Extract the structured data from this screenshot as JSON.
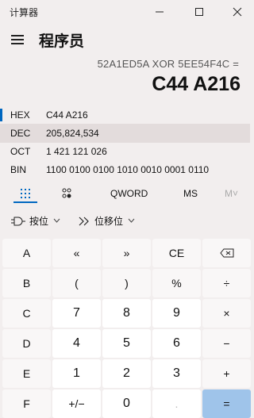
{
  "window": {
    "title": "计算器",
    "minimize": "—",
    "maximize": "☐",
    "close": "✕"
  },
  "header": {
    "mode": "程序员"
  },
  "display": {
    "expression": "52A1ED5A XOR 5EE54F4C =",
    "value": "C44 A216"
  },
  "radix": [
    {
      "name": "HEX",
      "value": "C44 A216"
    },
    {
      "name": "DEC",
      "value": "205,824,534"
    },
    {
      "name": "OCT",
      "value": "1 421 121 026"
    },
    {
      "name": "BIN",
      "value": "1100 0100 0100 1010 0010 0001 0110"
    }
  ],
  "tabs": {
    "keypad_icon": "keypad-icon",
    "bit_toggle_icon": "bit-toggle-icon",
    "word_size": "QWORD",
    "memory_store": "MS",
    "memory_list": "M˅"
  },
  "ops": {
    "bitwise": "按位",
    "bitshift": "位移位"
  },
  "keys": [
    [
      "A",
      "«",
      "»",
      "CE",
      "⌫"
    ],
    [
      "B",
      "(",
      ")",
      "%",
      "÷"
    ],
    [
      "C",
      "7",
      "8",
      "9",
      "×"
    ],
    [
      "D",
      "4",
      "5",
      "6",
      "−"
    ],
    [
      "E",
      "1",
      "2",
      "3",
      "+"
    ],
    [
      "F",
      "+/−",
      "0",
      ".",
      "="
    ]
  ],
  "colors": {
    "accent": "#0067c0",
    "equals": "#9fc4ea"
  }
}
